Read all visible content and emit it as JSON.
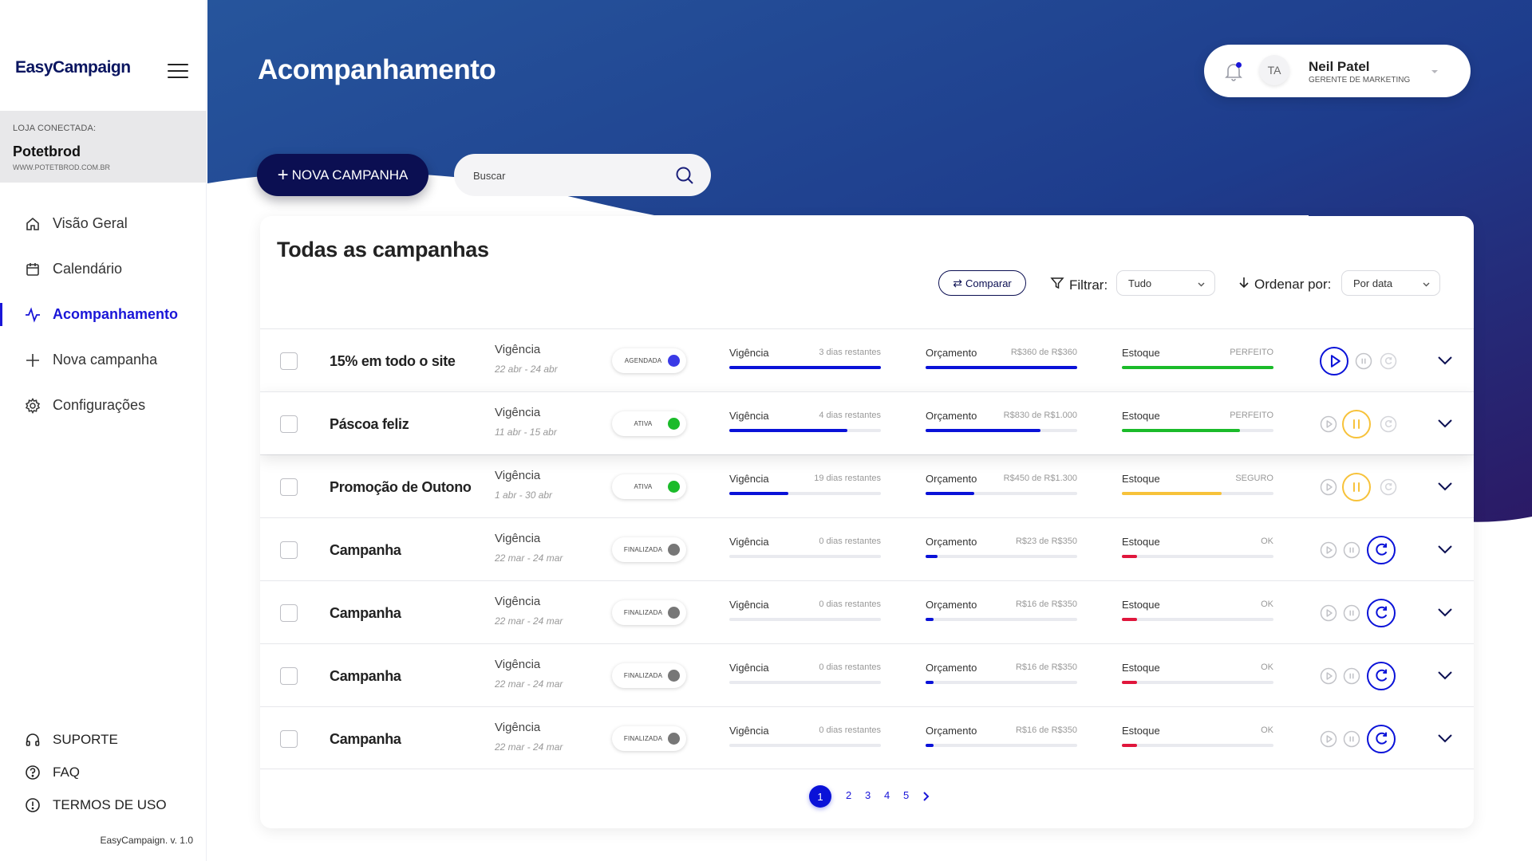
{
  "app": {
    "logo": "EasyCampaign",
    "version": "EasyCampaign. v. 1.0"
  },
  "store": {
    "label": "LOJA CONECTADA:",
    "name": "Potetbrod",
    "url": "WWW.POTETBROD.COM.BR"
  },
  "nav": {
    "items": [
      {
        "label": "Visão Geral",
        "icon": "home-icon"
      },
      {
        "label": "Calendário",
        "icon": "calendar-icon"
      },
      {
        "label": "Acompanhamento",
        "icon": "activity-icon",
        "active": true
      },
      {
        "label": "Nova campanha",
        "icon": "plus-icon"
      },
      {
        "label": "Configurações",
        "icon": "gear-icon"
      }
    ],
    "bottom": [
      {
        "label": "SUPORTE",
        "icon": "headphones-icon"
      },
      {
        "label": "FAQ",
        "icon": "help-circle-icon"
      },
      {
        "label": "TERMOS DE USO",
        "icon": "alert-circle-icon"
      }
    ]
  },
  "header": {
    "title": "Acompanhamento",
    "user": {
      "initials": "TA",
      "name": "Neil Patel",
      "role": "GERENTE DE MARKETING"
    }
  },
  "actions": {
    "new_campaign": "NOVA CAMPANHA",
    "search_placeholder": "Buscar"
  },
  "card": {
    "title": "Todas as campanhas",
    "compare_label": "Comparar",
    "filter_label": "Filtrar:",
    "filter_value": "Tudo",
    "order_label": "Ordenar por:",
    "order_value": "Por data"
  },
  "campaigns": [
    {
      "name": "15% em todo o site",
      "vig_label": "Vigência",
      "dates": "22 abr  -  24 abr",
      "status": "AGENDADA",
      "status_color": "#3a3ae6",
      "m_vig": "3 dias restantes",
      "m_vig_pct": 100,
      "m_orc": "R$360 de R$360",
      "m_orc_pct": 100,
      "m_est": "PERFEITO",
      "m_est_pct": 100,
      "est_color": "#1bbb2a",
      "state": "scheduled"
    },
    {
      "name": "Páscoa feliz",
      "vig_label": "Vigência",
      "dates": "11 abr  -  15 abr",
      "status": "ATIVA",
      "status_color": "#1bbb2a",
      "m_vig": "4 dias restantes",
      "m_vig_pct": 78,
      "m_orc": "R$830 de R$1.000",
      "m_orc_pct": 76,
      "m_est": "PERFEITO",
      "m_est_pct": 78,
      "est_color": "#1bbb2a",
      "state": "active",
      "highlighted": true
    },
    {
      "name": "Promoção de Outono",
      "vig_label": "Vigência",
      "dates": "1 abr  -  30 abr",
      "status": "ATIVA",
      "status_color": "#1bbb2a",
      "m_vig": "19 dias restantes",
      "m_vig_pct": 39,
      "m_orc": "R$450 de R$1.300",
      "m_orc_pct": 32,
      "m_est": "SEGURO",
      "m_est_pct": 66,
      "est_color": "#f7c23a",
      "state": "active"
    },
    {
      "name": "Campanha",
      "vig_label": "Vigência",
      "dates": "22 mar  -  24 mar",
      "status": "FINALIZADA",
      "status_color": "#777777",
      "m_vig": "0 dias restantes",
      "m_vig_pct": 0,
      "m_orc": "R$23 de R$350",
      "m_orc_pct": 8,
      "m_est": "OK",
      "m_est_pct": 10,
      "est_color": "#e0163c",
      "state": "finished"
    },
    {
      "name": "Campanha",
      "vig_label": "Vigência",
      "dates": "22 mar  -  24 mar",
      "status": "FINALIZADA",
      "status_color": "#777777",
      "m_vig": "0 dias restantes",
      "m_vig_pct": 0,
      "m_orc": "R$16 de R$350",
      "m_orc_pct": 5,
      "m_est": "OK",
      "m_est_pct": 10,
      "est_color": "#e0163c",
      "state": "finished"
    },
    {
      "name": "Campanha",
      "vig_label": "Vigência",
      "dates": "22 mar  -  24 mar",
      "status": "FINALIZADA",
      "status_color": "#777777",
      "m_vig": "0 dias restantes",
      "m_vig_pct": 0,
      "m_orc": "R$16 de R$350",
      "m_orc_pct": 5,
      "m_est": "OK",
      "m_est_pct": 10,
      "est_color": "#e0163c",
      "state": "finished"
    },
    {
      "name": "Campanha",
      "vig_label": "Vigência",
      "dates": "22 mar  -  24 mar",
      "status": "FINALIZADA",
      "status_color": "#777777",
      "m_vig": "0 dias restantes",
      "m_vig_pct": 0,
      "m_orc": "R$16 de R$350",
      "m_orc_pct": 5,
      "m_est": "OK",
      "m_est_pct": 10,
      "est_color": "#e0163c",
      "state": "finished"
    }
  ],
  "metric_labels": {
    "vig": "Vigência",
    "orc": "Orçamento",
    "est": "Estoque"
  },
  "colors": {
    "accent": "#1a16d8",
    "navy": "#0b0f52",
    "progress_blue": "#0a12d8",
    "pause_yellow": "#f7c23a"
  },
  "pagination": {
    "pages": [
      "1",
      "2",
      "3",
      "4",
      "5"
    ],
    "current": "1"
  }
}
